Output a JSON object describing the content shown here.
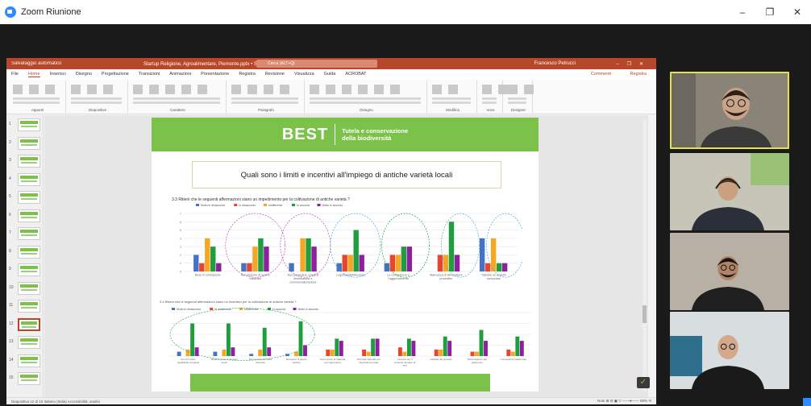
{
  "zoom": {
    "title": "Zoom Riunione",
    "window_controls": [
      "–",
      "❐",
      "✕"
    ]
  },
  "ppt": {
    "autosave_label": "Salvataggio automatico",
    "file_title": "Startup Religione, Agroalimentare, Piemonte.pptx • Salvato in questo PC ✓",
    "search_placeholder": "Cerca (ALT+Q)",
    "user": "Francesco Petrucci",
    "tabs": [
      "File",
      "Home",
      "Inserisci",
      "Disegno",
      "Progettazione",
      "Transizioni",
      "Animazioni",
      "Presentazione",
      "Registra",
      "Revisione",
      "Visualizza",
      "Guida",
      "ACROBAT"
    ],
    "active_tab": "Home",
    "share_label": "Registra",
    "comments_label": "Commenti",
    "ribbon_groups": [
      "Appunti",
      "Diapositive",
      "Carattere",
      "Paragrafo",
      "Disegno",
      "Modifica",
      "Voce",
      "Designer"
    ],
    "status_left": "Diapositiva 12 di 15    Italiano (Italia)    Accessibilità: analisi",
    "status_right": "Note    ⊞    ⊟    ▣    ▽   ——●——   59%   ⟲"
  },
  "thumbnails": [
    {
      "num": "1"
    },
    {
      "num": "2"
    },
    {
      "num": "3"
    },
    {
      "num": "4"
    },
    {
      "num": "5"
    },
    {
      "num": "6"
    },
    {
      "num": "7"
    },
    {
      "num": "8"
    },
    {
      "num": "9"
    },
    {
      "num": "10"
    },
    {
      "num": "11"
    },
    {
      "num": "12",
      "active": true
    },
    {
      "num": "13"
    },
    {
      "num": "14"
    },
    {
      "num": "15"
    }
  ],
  "slide": {
    "brand": "BEST",
    "subtitle_1": "Tutela e conservazione",
    "subtitle_2": "della biodiversità",
    "title": "Quali sono i limiti e incentivi all'impiego di antiche varietà locali",
    "question_1": "3.3  Ritieni che le seguenti affermazioni siano un impedimento per la coltivazione di antiche varietà ?",
    "question_2": "3.4  Ritieni che le seguenti affermazioni siano un incentivo per la coltivazione di antiche varietà ?"
  },
  "chart_data": [
    {
      "type": "bar",
      "title": "",
      "legend_position": "top",
      "legend": [
        "Molto in disaccordo",
        "In disaccordo",
        "Indifferente",
        "In accordo",
        "Molto in accordo"
      ],
      "colors": [
        "#4472c4",
        "#e8452c",
        "#f5a623",
        "#1e9e3e",
        "#8e1fa0"
      ],
      "categories": [
        "Rese in contrazione",
        "Non disporre di semi e materiale",
        "Non possedere canali di distribuzione e commercializzazione",
        "Logistica/distribuzione",
        "Le competenze e l'aggiornamento",
        "Mancanza di attrezzature produttive",
        "Tutelare un aspetto scorporato"
      ],
      "series": [
        {
          "name": "Molto in disaccordo",
          "values": [
            2,
            1,
            1,
            1,
            1,
            0,
            4
          ]
        },
        {
          "name": "In disaccordo",
          "values": [
            1,
            1,
            0,
            2,
            2,
            2,
            1
          ]
        },
        {
          "name": "Indifferente",
          "values": [
            4,
            3,
            4,
            2,
            2,
            2,
            4
          ]
        },
        {
          "name": "In accordo",
          "values": [
            3,
            4,
            4,
            5,
            3,
            6,
            1
          ]
        },
        {
          "name": "Molto in accordo",
          "values": [
            1,
            3,
            3,
            2,
            3,
            2,
            1
          ]
        }
      ],
      "ylim": [
        0,
        7
      ],
      "yticks": [
        "0",
        "1",
        "2",
        "3",
        "4",
        "5",
        "6",
        "7"
      ],
      "grid": true
    },
    {
      "type": "bar",
      "title": "",
      "legend_position": "top-left",
      "legend": [
        "Molto in disaccordo",
        "In disaccordo",
        "Indifferente",
        "In accordo",
        "Molto in accordo"
      ],
      "colors": [
        "#4472c4",
        "#e8452c",
        "#f5a623",
        "#1e9e3e",
        "#8e1fa0"
      ],
      "categories": [
        "Uso di territori riqualificati marginali",
        "Materia prima di sementi locali",
        "Riconoscimento della diversità",
        "Recupero di specie antiche",
        "Promozione di materiali per l'agricoltura",
        "Diversità varietale per l'agricoltura locale",
        "Incentivi per il territorio da parte di enti",
        "Visibilità del prodotto",
        "Valorizzazione del patrimonio",
        "Conoscenze tradizionali"
      ],
      "series": [
        {
          "name": "Molto in disaccordo",
          "values": [
            0.2,
            0.2,
            0.1,
            0.1,
            0,
            0,
            0,
            0,
            0,
            0
          ]
        },
        {
          "name": "In disaccordo",
          "values": [
            0,
            0,
            0,
            0,
            0.3,
            0.3,
            0.4,
            0.3,
            0.2,
            0.3
          ]
        },
        {
          "name": "Indifferente",
          "values": [
            0.3,
            0.3,
            0.3,
            0.2,
            0.3,
            0.2,
            0.2,
            0.3,
            0.2,
            0.2
          ]
        },
        {
          "name": "In accordo",
          "values": [
            1.5,
            1.5,
            1.3,
            1.6,
            0.8,
            0.8,
            0.8,
            0.9,
            1.2,
            0.9
          ]
        },
        {
          "name": "Molto in accordo",
          "values": [
            0.4,
            0.4,
            0.4,
            0.5,
            0.7,
            0.8,
            0.7,
            0.7,
            0.7,
            0.7
          ]
        }
      ],
      "ylim": [
        0,
        2
      ],
      "grid": true
    }
  ],
  "participants": [
    {
      "tile": 1,
      "speaking": true,
      "bg": "#8a8478",
      "skin": "#c9a488",
      "hair": "#2a2018",
      "shirt": "#3a3a3a",
      "glasses": true
    },
    {
      "tile": 2,
      "speaking": false,
      "bg": "#c7c4b8",
      "skin": "#c9a080",
      "hair": "#4a3728",
      "shirt": "#2b2f3a",
      "headset": true,
      "wall": "#7cc24a"
    },
    {
      "tile": 3,
      "speaking": false,
      "bg": "#b8b0a4",
      "skin": "#b08468",
      "hair": "#1a1410",
      "shirt": "#1f1f1f",
      "glasses": true
    },
    {
      "tile": 4,
      "speaking": false,
      "bg": "#d8dde0",
      "skin": "#d4a88a",
      "hair": "#c9a488",
      "shirt": "#1a1a1a",
      "glasses": true,
      "bald": true
    }
  ]
}
